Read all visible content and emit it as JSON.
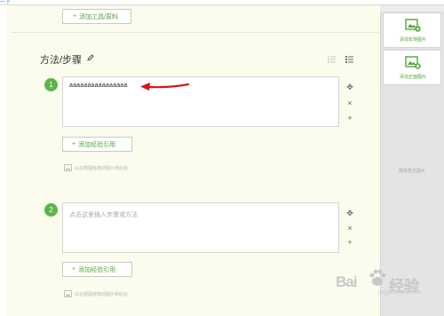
{
  "topbar": {
    "link_text": "一下"
  },
  "toolbar": {
    "add_tool_label": "添加工具/原料",
    "plus": "+"
  },
  "section": {
    "title": "方法/步骤"
  },
  "steps": [
    {
      "number": "1",
      "text": "aaaaaaaaaaaaaaaa",
      "placeholder": "",
      "add_exp_label": "添加经验引用",
      "drag_hint": "从右侧图库拖动图片到此处"
    },
    {
      "number": "2",
      "text": "",
      "placeholder": "点击这里输入步骤或方法",
      "add_exp_label": "添加经验引用",
      "drag_hint": "从右侧图库拖动图片到此处"
    }
  ],
  "controls": {
    "move": "✥",
    "delete": "×",
    "add": "+"
  },
  "sidebar": {
    "add_local_label": "添加本地图片",
    "add_mobile_label": "添加正面图片",
    "empty_note": "图库暂无图片"
  },
  "watermark": {
    "brand": "Bai",
    "brand2": "经验",
    "url": "jingyan.baidu.com"
  },
  "colors": {
    "accent": "#5bb548",
    "link": "#52a536",
    "arrow": "#d6151d"
  }
}
